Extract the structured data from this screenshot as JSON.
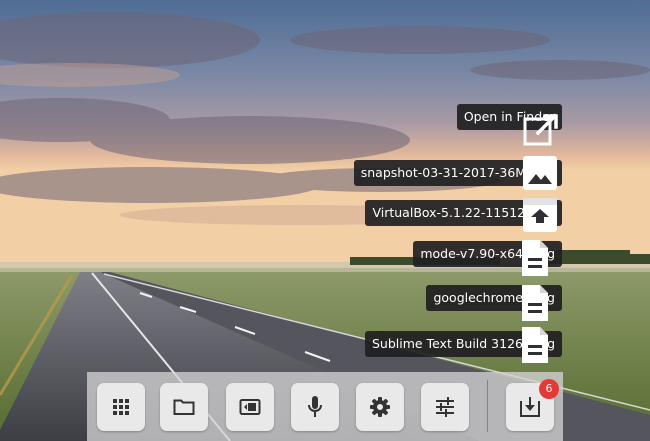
{
  "downloads": {
    "open_in_finder_label": "Open in Finder",
    "items": [
      {
        "label": "snapshot-03-31-2017-36MP.jpg",
        "icon": "image-icon"
      },
      {
        "label": "VirtualBox-5.1.22-115126.zip",
        "icon": "archive-icon"
      },
      {
        "label": "mode-v7.90-x64.dmg",
        "icon": "file-icon"
      },
      {
        "label": "googlechrome.dmg",
        "icon": "file-icon"
      },
      {
        "label": "Sublime Text Build 3126.dmg",
        "icon": "file-icon"
      }
    ]
  },
  "shelf": {
    "buttons": [
      "apps-grid-icon",
      "folder-icon",
      "screen-icon",
      "microphone-icon",
      "gear-icon",
      "sliders-icon",
      "download-icon"
    ],
    "downloads_badge": "6"
  },
  "colors": {
    "badge": "#e53935",
    "label_bg": "#202022",
    "shelf_button": "#e9e9ea"
  }
}
